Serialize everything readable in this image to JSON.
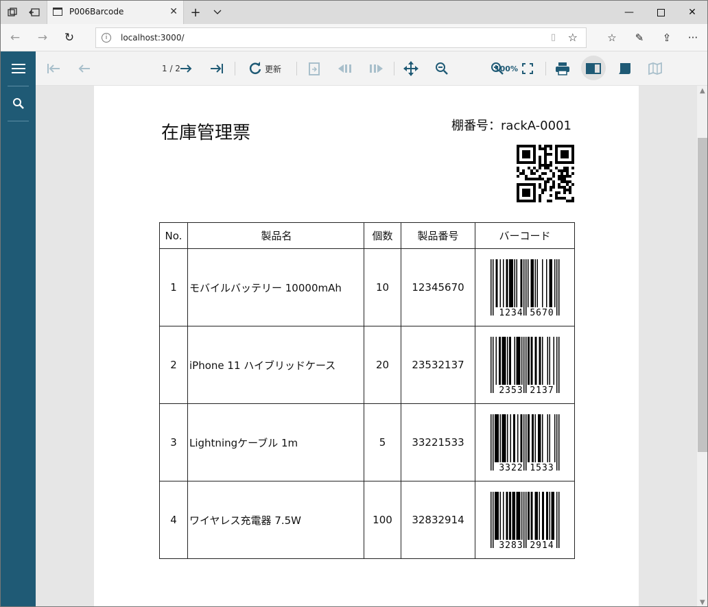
{
  "browser": {
    "tab_title": "P006Barcode",
    "url": "localhost:3000/"
  },
  "viewer": {
    "page_indicator": "1 / 2",
    "refresh_label": "更新",
    "zoom_label": "100%"
  },
  "report": {
    "title": "在庫管理票",
    "rack_label": "棚番号：rackA-0001",
    "columns": [
      "No.",
      "製品名",
      "個数",
      "製品番号",
      "バーコード"
    ],
    "rows": [
      {
        "no": "1",
        "name": "モバイルバッテリー 10000mAh",
        "qty": "10",
        "code": "12345670",
        "bar_left": "1234",
        "bar_right": "5670"
      },
      {
        "no": "2",
        "name": "iPhone 11 ハイブリッドケース",
        "qty": "20",
        "code": "23532137",
        "bar_left": "2353",
        "bar_right": "2137"
      },
      {
        "no": "3",
        "name": "Lightningケーブル 1m",
        "qty": "5",
        "code": "33221533",
        "bar_left": "3322",
        "bar_right": "1533"
      },
      {
        "no": "4",
        "name": "ワイヤレス充電器 7.5W",
        "qty": "100",
        "code": "32832914",
        "bar_left": "3283",
        "bar_right": "2914"
      }
    ]
  },
  "colors": {
    "sidebar": "#1f5a75",
    "toolbar_icon": "#1f5a75"
  }
}
